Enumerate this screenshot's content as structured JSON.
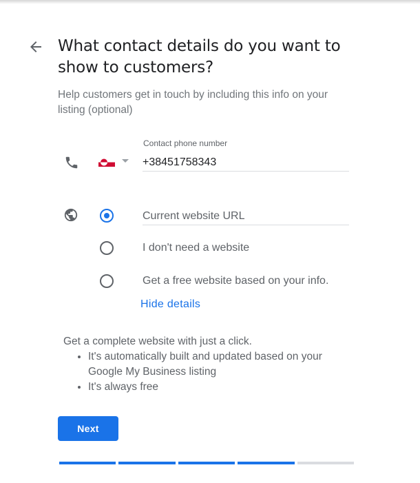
{
  "header": {
    "title": "What contact details do you want to show to customers?",
    "subtitle": "Help customers get in touch by including this info on your listing (optional)",
    "back_icon": "arrow-back-icon"
  },
  "phone": {
    "icon": "phone-icon",
    "country_flag": "greenland-flag",
    "label": "Contact phone number",
    "value": "+38451758343"
  },
  "website": {
    "icon": "globe-icon",
    "options": [
      {
        "label": "Current website URL",
        "type": "input",
        "placeholder": "Current website URL",
        "value": "",
        "selected": true
      },
      {
        "label": "I don't need a website",
        "selected": false
      },
      {
        "label": "Get a free website based on your info.",
        "selected": false
      }
    ],
    "hide_details_label": "Hide details"
  },
  "details": {
    "intro": "Get a complete website with just a click.",
    "bullets": [
      "It's automatically built and updated based on your Google My Business listing",
      "It's always free"
    ]
  },
  "actions": {
    "next_label": "Next"
  },
  "progress": {
    "steps_total": 5,
    "steps_completed": 4
  },
  "colors": {
    "accent": "#1a73e8",
    "text_primary": "#202124",
    "text_secondary": "#5f6368",
    "flag_red": "#d00c33"
  }
}
